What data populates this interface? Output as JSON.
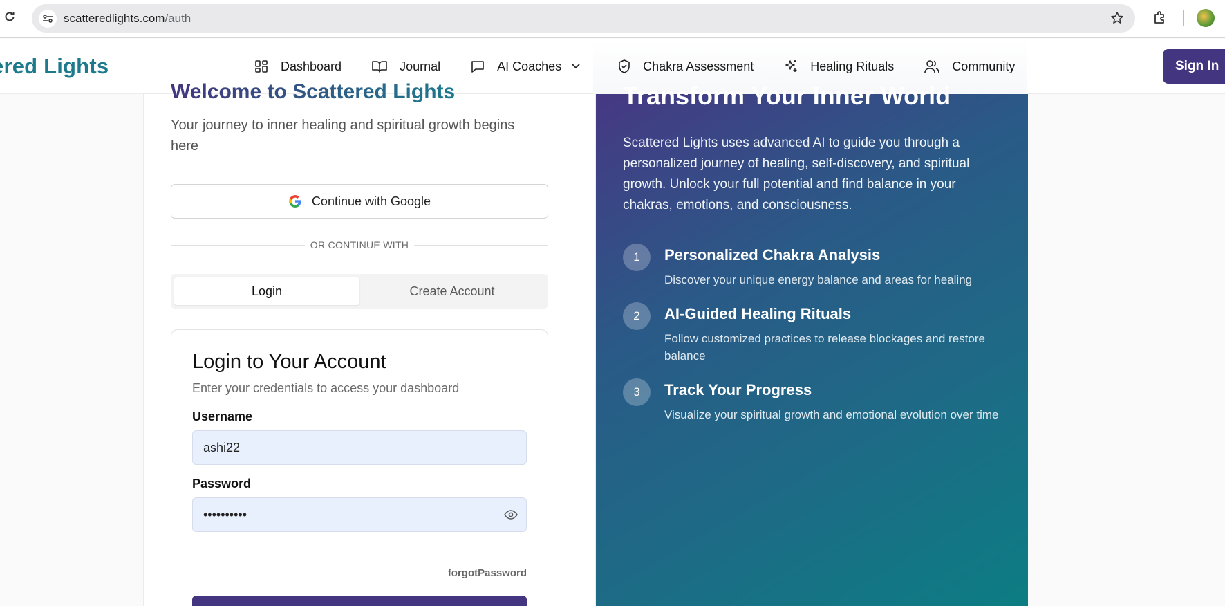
{
  "browser": {
    "url_host": "scatteredlights.com",
    "url_path": "/auth"
  },
  "header": {
    "brand": "ered Lights",
    "nav": [
      {
        "label": "Dashboard",
        "icon": "dashboard-icon"
      },
      {
        "label": "Journal",
        "icon": "book-icon"
      },
      {
        "label": "AI Coaches",
        "icon": "chat-icon"
      },
      {
        "label": "Chakra Assessment",
        "icon": "shield-icon"
      },
      {
        "label": "Healing Rituals",
        "icon": "sparkles-icon"
      },
      {
        "label": "Community",
        "icon": "users-icon"
      }
    ],
    "sign_in": "Sign In"
  },
  "auth": {
    "welcome": "Welcome to Scattered Lights",
    "subtitle": "Your journey to inner healing and spiritual growth begins here",
    "google_button": "Continue with Google",
    "divider": "OR CONTINUE WITH",
    "tabs": [
      "Login",
      "Create Account"
    ],
    "login_title": "Login to Your Account",
    "login_subtitle": "Enter your credentials to access your dashboard",
    "username_label": "Username",
    "username_value": "ashi22",
    "password_label": "Password",
    "password_value": "••••••••••",
    "forgot": "forgotPassword"
  },
  "panel": {
    "title": "Transform Your Inner World",
    "intro": "Scattered Lights uses advanced AI to guide you through a personalized journey of healing, self-discovery, and spiritual growth. Unlock your full potential and find balance in your chakras, emotions, and consciousness.",
    "features": [
      {
        "num": "1",
        "title": "Personalized Chakra Analysis",
        "desc": "Discover your unique energy balance and areas for healing"
      },
      {
        "num": "2",
        "title": "AI-Guided Healing Rituals",
        "desc": "Follow customized practices to release blockages and restore balance"
      },
      {
        "num": "3",
        "title": "Track Your Progress",
        "desc": "Visualize your spiritual growth and emotional evolution over time"
      }
    ]
  },
  "colors": {
    "brand": "#1d7a8c",
    "primary": "#43357f",
    "panel_start": "#463884",
    "panel_end": "#0c7d83"
  }
}
